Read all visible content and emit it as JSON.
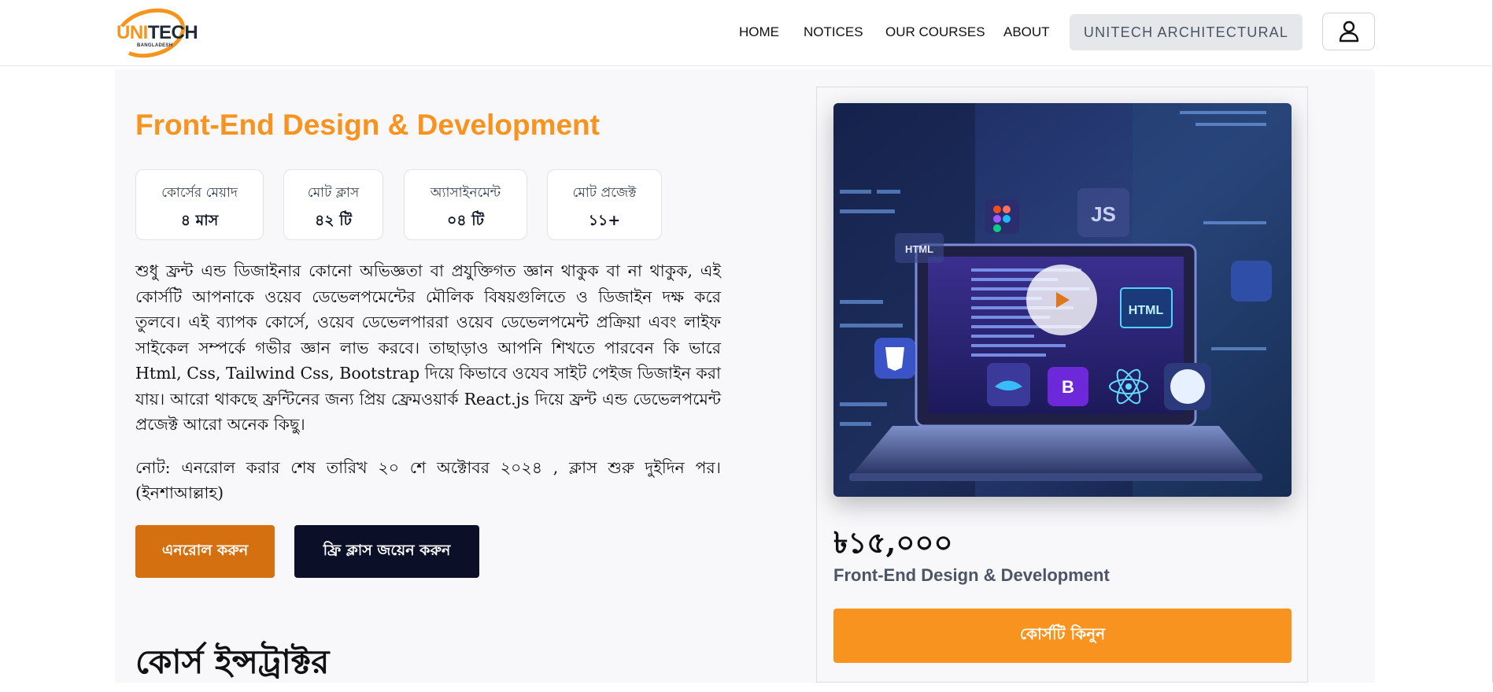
{
  "header": {
    "logo_main": "UNITECH",
    "logo_sub": "BANGLADESH",
    "nav": [
      "HOME",
      "NOTICES",
      "OUR COURSES",
      "ABOUT"
    ],
    "arch_button": "UNITECH ARCHITECTURAL",
    "user_icon": "user-icon"
  },
  "course": {
    "title": "Front-End Design & Development",
    "stats": [
      {
        "label": "কোর্সের মেয়াদ",
        "value": "৪ মাস"
      },
      {
        "label": "মোট ক্লাস",
        "value": "৪২ টি"
      },
      {
        "label": "অ্যাসাইনমেন্ট",
        "value": "০৪ টি"
      },
      {
        "label": "মোট প্রজেক্ট",
        "value": "১১+"
      }
    ],
    "description": "শুধু ফ্রন্ট এন্ড ডিজাইনার কোনো অভিজ্ঞতা বা প্রযুক্তিগত জ্ঞান থাকুক বা না থাকুক, এই কোর্সটি আপনাকে ওয়েব ডেভেলপমেন্টের মৌলিক বিষয়গুলিতে ও ডিজাইন দক্ষ করে তুলবে। এই ব্যাপক কোর্সে, ওয়েব ডেভেলপাররা ওয়েব ডেভেলপমেন্ট প্রক্রিয়া এবং লাইফ সাইকেল সম্পর্কে গভীর জ্ঞান লাভ করবে। তাছাড়াও আপনি শিখতে পারবেন কি ভারে Html, Css, Tailwind Css, Bootstrap দিয়ে কিভাবে ওযেব সাইট পেইজ ডিজাইন করা যায়। আরো থাকছে ফ্রন্টিনের জন্য প্রিয় ফ্রেমওয়ার্ক React.js দিয়ে ফ্রন্ট এন্ড ডেভেলপমেন্ট প্রজেক্ট আরো অনেক কিছু।",
    "note": "নোট: এনরোল করার শেষ তারিখ ২০ শে অক্টোবর ২০২৪ , ক্লাস শুরু দুইদিন পর। (ইনশাআল্লাহ)",
    "enroll_button": "এনরোল করুন",
    "free_class_button": "ফ্রি ক্লাস জয়েন করুন",
    "instructor_heading": "কোর্স ইন্সট্রাক্টর"
  },
  "card": {
    "thumb_labels": {
      "js": "JS",
      "html_left": "HTML",
      "html_screen": "HTML"
    },
    "price": "৳১৫,০০০",
    "name": "Front-End Design & Development",
    "buy_button": "কোর্সটি কিনুন"
  },
  "colors": {
    "accent": "#f7931e",
    "enroll": "#d4700f",
    "dark": "#0b1028"
  }
}
